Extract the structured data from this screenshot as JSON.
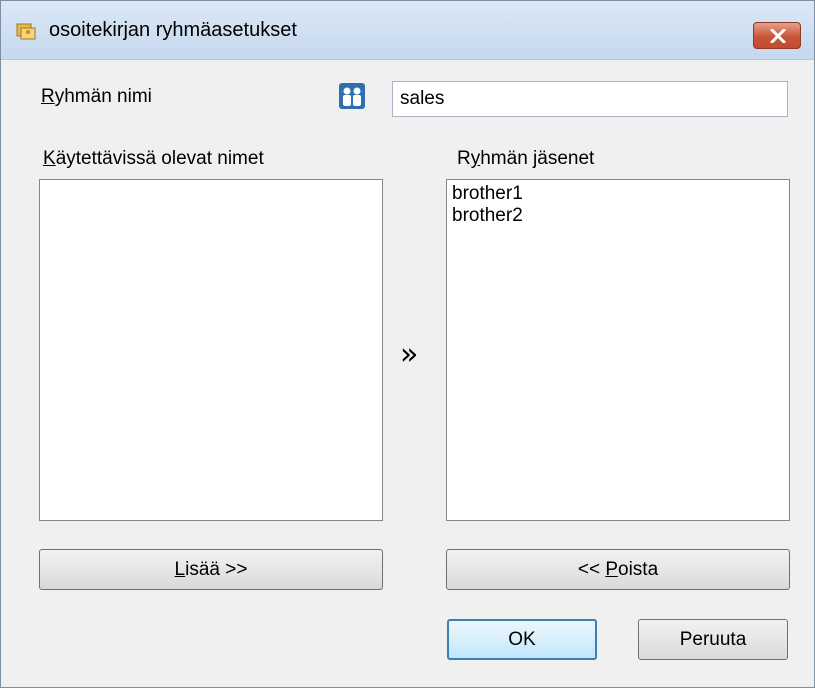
{
  "window": {
    "title": "osoitekirjan ryhmäasetukset",
    "close_icon": "close-x-icon"
  },
  "group_name": {
    "label_accel": "R",
    "label_rest": "yhmän nimi",
    "icon": "people-icon",
    "value": "sales"
  },
  "available": {
    "label_accel": "K",
    "label_rest": "äytettävissä olevat nimet",
    "items": []
  },
  "members": {
    "label_pre": "R",
    "label_accel": "y",
    "label_rest": "hmän jäsenet",
    "items": [
      "brother1",
      "brother2"
    ]
  },
  "arrows_glyph": "»",
  "buttons": {
    "add_accel": "L",
    "add_rest": "isää >>",
    "remove_pre": "<< ",
    "remove_accel": "P",
    "remove_rest": "oista",
    "ok": "OK",
    "cancel": "Peruuta"
  },
  "colors": {
    "titlebar": "#c6d8ee",
    "close_button": "#c9553b",
    "dialog_bg": "#f0f0f0",
    "default_button_border": "#3c7fb1"
  }
}
